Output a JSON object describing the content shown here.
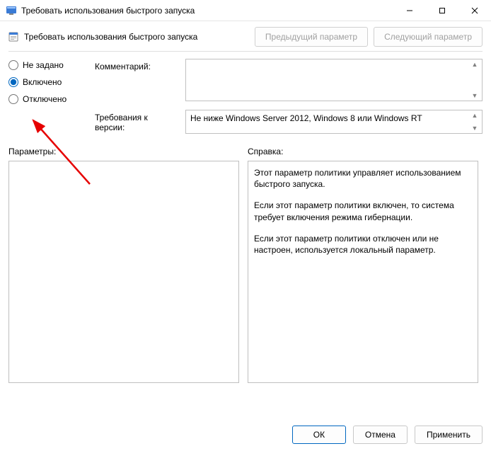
{
  "window": {
    "title": "Требовать использования быстрого запуска"
  },
  "subtitle": "Требовать использования быстрого запуска",
  "nav": {
    "prev": "Предыдущий параметр",
    "next": "Следующий параметр"
  },
  "radios": {
    "not_configured": "Не задано",
    "enabled": "Включено",
    "disabled": "Отключено",
    "selected": "enabled"
  },
  "fields": {
    "comment_label": "Комментарий:",
    "comment_value": "",
    "req_label": "Требования к версии:",
    "req_value": "Не ниже Windows Server 2012, Windows 8 или Windows RT"
  },
  "sections": {
    "params_label": "Параметры:",
    "help_label": "Справка:"
  },
  "help_text": {
    "p1": "Этот параметр политики управляет использованием быстрого запуска.",
    "p2": "Если этот параметр политики включен, то система требует включения режима гибернации.",
    "p3": "Если этот параметр политики отключен или не настроен, используется локальный параметр."
  },
  "buttons": {
    "ok": "ОК",
    "cancel": "Отмена",
    "apply": "Применить"
  }
}
